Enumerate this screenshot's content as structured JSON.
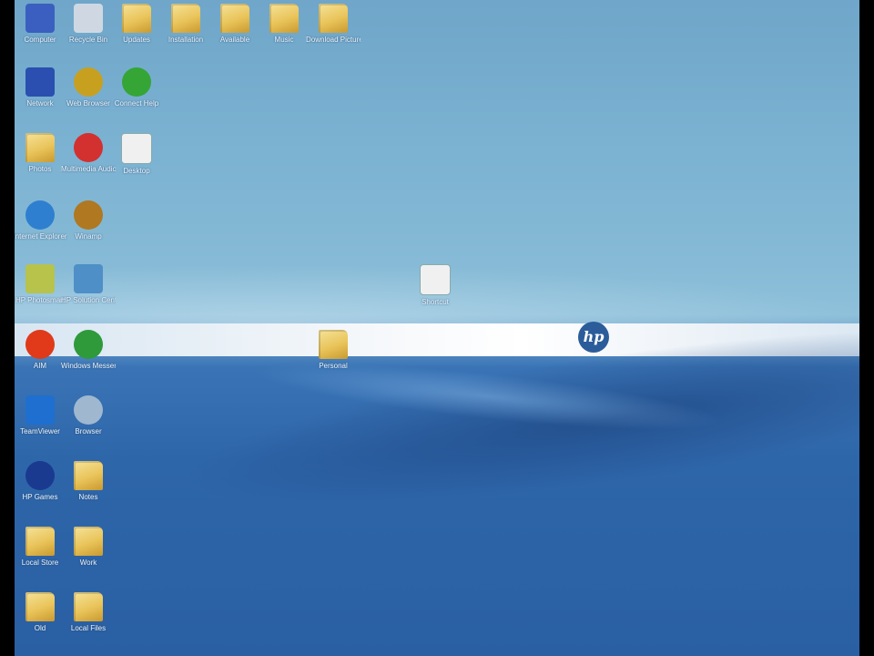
{
  "desktop": {
    "brand_logo_text": "hp",
    "icons": [
      {
        "name": "my-computer-icon",
        "label": "Computer",
        "color": "#3b5fc0"
      },
      {
        "name": "recycle-bin-icon",
        "label": "Recycle Bin",
        "color": "#cfd8e2"
      },
      {
        "name": "folder-icon",
        "label": "Updates",
        "color": "#e9c45a"
      },
      {
        "name": "folder-icon",
        "label": "Installation",
        "color": "#e9c45a"
      },
      {
        "name": "document-icon",
        "label": "Available",
        "color": "#e9c45a"
      },
      {
        "name": "folder-icon",
        "label": "Music",
        "color": "#e9c45a"
      },
      {
        "name": "folder-icon",
        "label": "Download Pictures",
        "color": "#e9c45a"
      },
      {
        "name": "network-icon",
        "label": "Network",
        "color": "#2a4fb0"
      },
      {
        "name": "globe-icon",
        "label": "Web Browser",
        "color": "#c8a020"
      },
      {
        "name": "green-orb-icon",
        "label": "Connect Help",
        "color": "#35a535"
      },
      {
        "name": "folder-icon",
        "label": "Photos",
        "color": "#e9c45a"
      },
      {
        "name": "red-app-icon",
        "label": "Multimedia Audio",
        "color": "#d33030"
      },
      {
        "name": "window-icon",
        "label": "Desktop",
        "color": "#f0f0f0"
      },
      {
        "name": "ie-icon",
        "label": "Internet Explorer",
        "color": "#2f7fd0"
      },
      {
        "name": "winamp-icon",
        "label": "Winamp",
        "color": "#b07820"
      },
      {
        "name": "hp-app-icon",
        "label": "HP Photosmart",
        "color": "#b7c34a"
      },
      {
        "name": "hp-support-icon",
        "label": "HP Solution Center",
        "color": "#4f8fc7"
      },
      {
        "name": "aim-icon",
        "label": "AIM",
        "color": "#e03a1a"
      },
      {
        "name": "messenger-icon",
        "label": "Windows Messenger",
        "color": "#2e9a3a"
      },
      {
        "name": "teamviewer-icon",
        "label": "TeamViewer",
        "color": "#1f6fd0"
      },
      {
        "name": "globe-gray-icon",
        "label": "Browser",
        "color": "#9fb8d0"
      },
      {
        "name": "hp-circle-icon",
        "label": "HP Games",
        "color": "#1a3a90"
      },
      {
        "name": "document-icon",
        "label": "Notes",
        "color": "#e9c45a"
      },
      {
        "name": "folder-icon",
        "label": "Local Store",
        "color": "#e9c45a"
      },
      {
        "name": "folder-icon",
        "label": "Work",
        "color": "#e9c45a"
      },
      {
        "name": "folder-icon",
        "label": "Old",
        "color": "#e9c45a"
      },
      {
        "name": "folder-icon",
        "label": "Local Files",
        "color": "#e9c45a"
      },
      {
        "name": "window-icon",
        "label": "Shortcut",
        "color": "#f0f0f0"
      },
      {
        "name": "folder-icon",
        "label": "Personal",
        "color": "#e9c45a"
      }
    ]
  }
}
